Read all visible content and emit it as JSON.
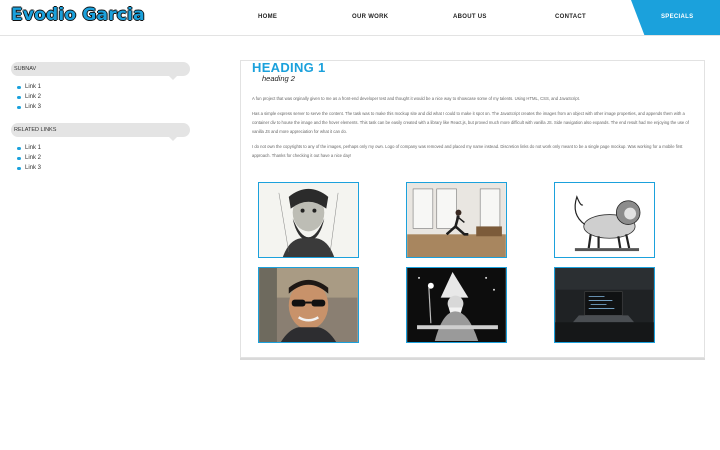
{
  "header": {
    "logo": "Evodio Garcia",
    "nav": [
      {
        "label": "HOME"
      },
      {
        "label": "OUR WORK"
      },
      {
        "label": "ABOUT US"
      },
      {
        "label": "CONTACT"
      }
    ],
    "specials_label": "SPECIALS"
  },
  "sidebar": {
    "subnav_title": "SUBNAV",
    "subnav_links": [
      {
        "label": "Link 1"
      },
      {
        "label": "Link 2"
      },
      {
        "label": "Link 3"
      }
    ],
    "related_title": "RELATED LINKS",
    "related_links": [
      {
        "label": "Link 1"
      },
      {
        "label": "Link 2"
      },
      {
        "label": "Link 3"
      }
    ]
  },
  "main": {
    "heading1": "HEADING 1",
    "heading2": "heading 2",
    "paragraphs": [
      "A fun project that was orginally given to me as a front-end developer test and thought it would be a nice way to showcase some of my talents. Using HTML, CSS, and JavaScript.",
      "Has a simple express server to serve the content. The task was to make this mockup site and did what I could to make it spot on. The JavaScript creates the images from an object with other image properties, and appends them with a container div to house the image and the hover elements. This task can be easily created with a library like React.js, but proved much more difficult with vanilla JS. Side navigation also expands. The end result had me enjoying the use of vanilla JS and more appreciation for what it can do.",
      "I do not own the copyrights to any of the images, perhaps only my own. Logo of company was removed and placed my name instead. Discretion links do not work only meant to be a single page mockup. Was working for a mobile first approach. Thanks for checking it out have a nice day!"
    ],
    "gallery": [
      {
        "icon": "bearded-man-engraving-image"
      },
      {
        "icon": "yoga-woman-image"
      },
      {
        "icon": "lion-engraving-image"
      },
      {
        "icon": "man-sunglasses-photo-image"
      },
      {
        "icon": "wizard-illustration-image"
      },
      {
        "icon": "laptop-dark-desk-image"
      }
    ]
  },
  "colors": {
    "accent": "#1ba1dc",
    "text": "#333333",
    "muted_text": "#666666",
    "sidebar_bg": "#e4e4e4"
  }
}
